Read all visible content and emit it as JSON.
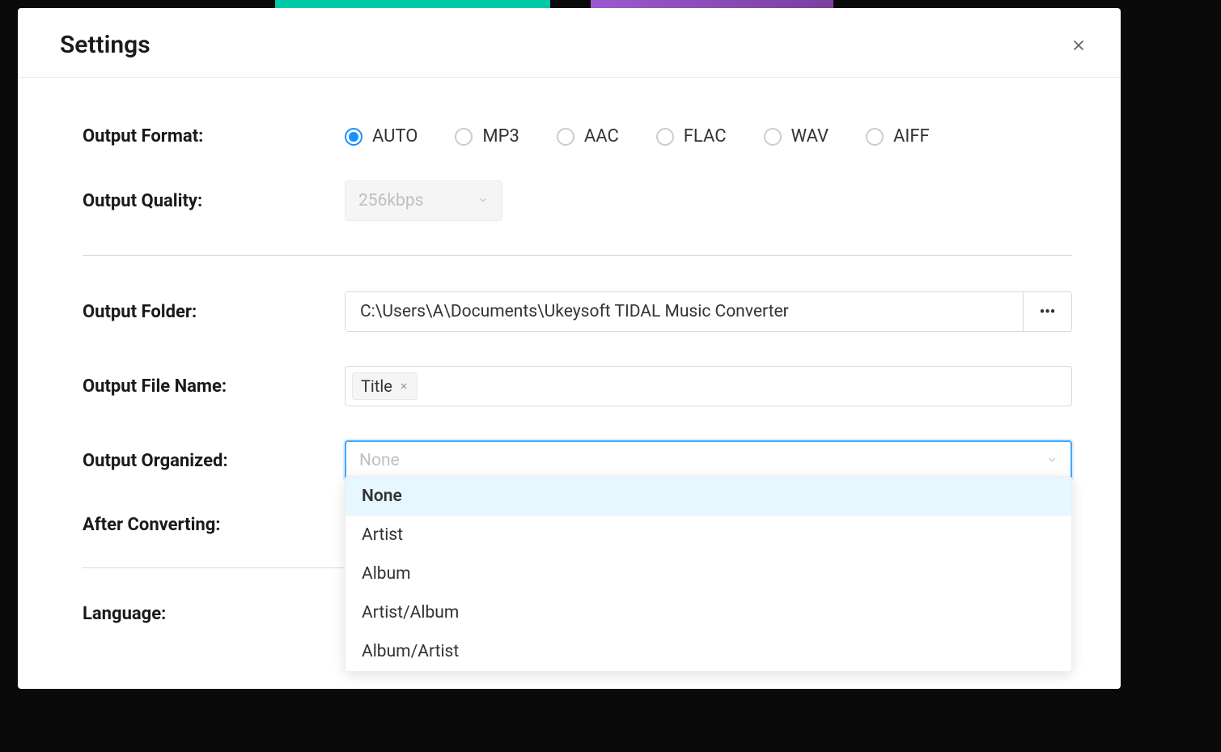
{
  "modal": {
    "title": "Settings"
  },
  "output_format": {
    "label": "Output Format:",
    "options": [
      "AUTO",
      "MP3",
      "AAC",
      "FLAC",
      "WAV",
      "AIFF"
    ],
    "selected": "AUTO"
  },
  "output_quality": {
    "label": "Output Quality:",
    "value": "256kbps"
  },
  "output_folder": {
    "label": "Output Folder:",
    "value": "C:\\Users\\A\\Documents\\Ukeysoft TIDAL Music Converter",
    "browse": "•••"
  },
  "output_file_name": {
    "label": "Output File Name:",
    "tags": [
      "Title"
    ]
  },
  "output_organized": {
    "label": "Output Organized:",
    "placeholder": "None",
    "options": [
      "None",
      "Artist",
      "Album",
      "Artist/Album",
      "Album/Artist"
    ]
  },
  "after_converting": {
    "label": "After Converting:"
  },
  "language": {
    "label": "Language:"
  }
}
